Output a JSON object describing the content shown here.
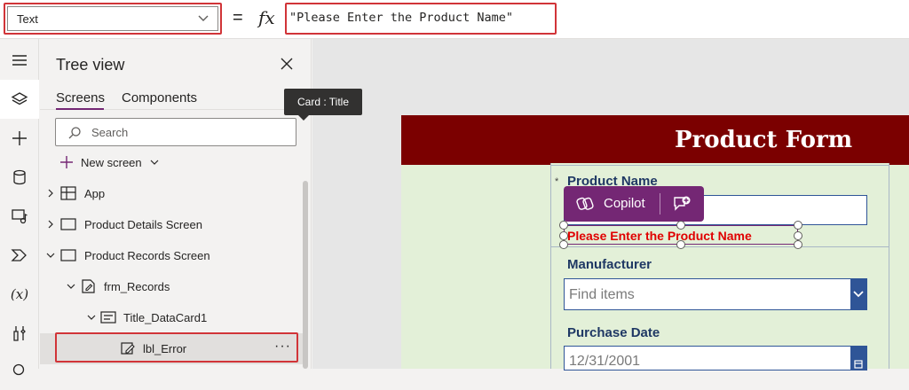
{
  "formula_bar": {
    "property": "Text",
    "equals": "=",
    "fx": "fx",
    "formula": "\"Please Enter the Product Name\""
  },
  "rail": {
    "items": [
      "menu-icon",
      "layers-icon",
      "insert-icon",
      "data-icon",
      "media-icon",
      "power-automate-icon",
      "variables-icon",
      "advanced-tools-icon"
    ],
    "variables_glyph": "(x)"
  },
  "tree_view": {
    "title": "Tree view",
    "tabs": [
      {
        "label": "Screens",
        "active": true
      },
      {
        "label": "Components",
        "active": false
      }
    ],
    "search_placeholder": "Search",
    "new_screen_label": "New screen",
    "items": [
      {
        "label": "App",
        "expanded": false
      },
      {
        "label": "Product Details Screen",
        "expanded": false
      },
      {
        "label": "Product Records Screen",
        "expanded": true
      },
      {
        "label": "frm_Records",
        "expanded": true
      },
      {
        "label": "Title_DataCard1",
        "expanded": true
      },
      {
        "label": "lbl_Error",
        "selected": true
      }
    ],
    "more": "···"
  },
  "canvas": {
    "form_title": "Product Form",
    "tooltip": "Card : Title",
    "required_marker": "*",
    "fields": [
      {
        "label": "Product Name"
      },
      {
        "label": "Manufacturer",
        "placeholder": "Find items"
      },
      {
        "label": "Purchase Date",
        "value": "12/31/2001"
      }
    ],
    "copilot_label": "Copilot",
    "error_text": "Please Enter the Product Name",
    "colors": {
      "header": "#7b0000",
      "form_bg": "#e3f0d8",
      "label": "#1f3864",
      "error": "#e00000",
      "accent": "#742774",
      "highlight": "#d13438"
    }
  }
}
